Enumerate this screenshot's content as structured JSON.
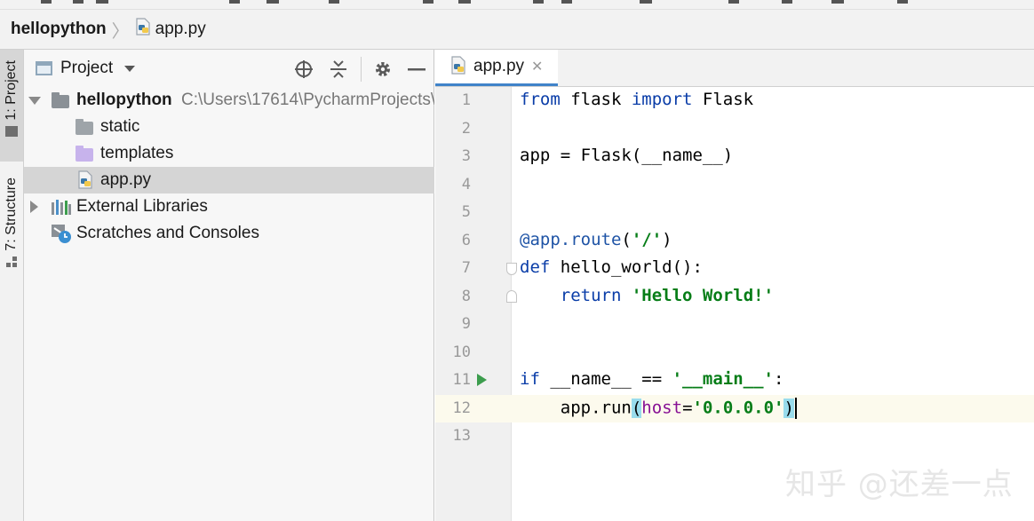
{
  "navbar": {
    "project": "hellopython",
    "file": "app.py"
  },
  "stripe": {
    "project_tab": "1: Project",
    "structure_tab": "7: Structure"
  },
  "panel": {
    "title": "Project",
    "tree": [
      {
        "label": "hellopython",
        "path": "C:\\Users\\17614\\PycharmProjects\\",
        "kind": "project-root"
      },
      {
        "label": "static",
        "kind": "folder"
      },
      {
        "label": "templates",
        "kind": "folder-templates"
      },
      {
        "label": "app.py",
        "kind": "python-file",
        "selected": true
      },
      {
        "label": "External Libraries",
        "kind": "libraries"
      },
      {
        "label": "Scratches and Consoles",
        "kind": "scratches"
      }
    ]
  },
  "editor": {
    "tab_label": "app.py",
    "line_numbers": [
      "1",
      "2",
      "3",
      "4",
      "5",
      "6",
      "7",
      "8",
      "9",
      "10",
      "11",
      "12",
      "13"
    ],
    "current_line": 12,
    "code": {
      "l1": {
        "kw1": "from",
        "mod": " flask ",
        "kw2": "import",
        "name": " Flask"
      },
      "l3": {
        "text": "app = Flask(__name__)"
      },
      "l6": {
        "deco": "@app.route",
        "open": "(",
        "str": "'/'",
        "close": ")"
      },
      "l7": {
        "kw": "def",
        "rest": " hello_world():"
      },
      "l8": {
        "indent": "    ",
        "kw": "return",
        "sp": " ",
        "str": "'Hello World!'"
      },
      "l11": {
        "kw": "if",
        "mid": " __name__ == ",
        "str": "'__main__'",
        "end": ":"
      },
      "l12": {
        "pre": "    app.run",
        "open": "(",
        "param": "host",
        "eq": "=",
        "str": "'0.0.0.0'",
        "close": ")"
      }
    }
  },
  "watermark": "知乎 @还差一点",
  "colors": {
    "keyword": "#0a3da8",
    "string": "#067d17",
    "param": "#871094",
    "accent": "#4083c9",
    "run": "#3c9d4d"
  }
}
